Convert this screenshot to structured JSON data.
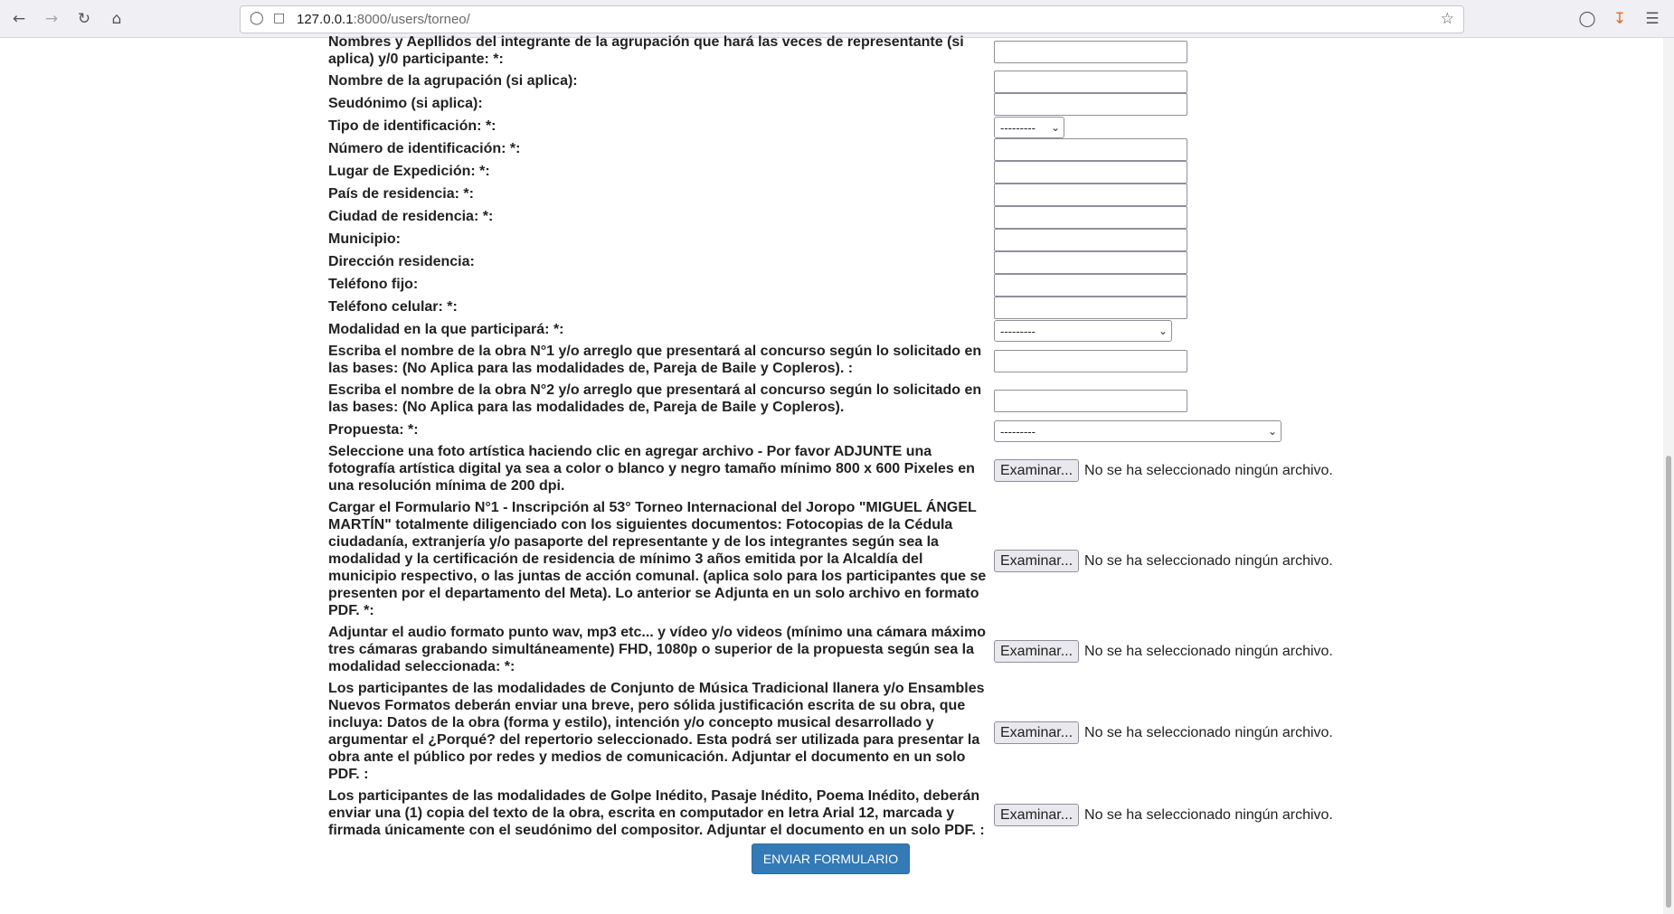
{
  "browser": {
    "url_host": "127.0.0.1",
    "url_rest": ":8000/users/torneo/"
  },
  "form": {
    "fields": [
      {
        "label": "Nombres y Aepllidos del integrante de la agrupación que hará las veces de representante (si aplica) y/0 participante: *:",
        "type": "text"
      },
      {
        "label": "Nombre de la agrupación (si aplica):",
        "type": "text"
      },
      {
        "label": "Seudónimo (si aplica):",
        "type": "text"
      },
      {
        "label": "Tipo de identificación: *:",
        "type": "select",
        "value": "---------"
      },
      {
        "label": "Número de identificación: *:",
        "type": "text"
      },
      {
        "label": "Lugar de Expedición: *:",
        "type": "text"
      },
      {
        "label": "País de residencia: *:",
        "type": "text"
      },
      {
        "label": "Ciudad de residencia: *:",
        "type": "text"
      },
      {
        "label": "Municipio:",
        "type": "text"
      },
      {
        "label": "Dirección residencia:",
        "type": "text"
      },
      {
        "label": "Teléfono fijo:",
        "type": "text"
      },
      {
        "label": "Teléfono celular: *:",
        "type": "text"
      },
      {
        "label": "Modalidad en la que participará: *:",
        "type": "select",
        "value": "---------"
      },
      {
        "label": "Escriba el nombre de la obra N°1 y/o arreglo que presentará al concurso según lo solicitado en las bases: (No Aplica para las modalidades de, Pareja de Baile y Copleros). :",
        "type": "text"
      },
      {
        "label": "Escriba el nombre de la obra N°2 y/o arreglo que presentará al concurso según lo solicitado en las bases: (No Aplica para las modalidades de, Pareja de Baile y Copleros).",
        "type": "text"
      },
      {
        "label": "Propuesta: *:",
        "type": "select",
        "value": "---------"
      },
      {
        "label": "Seleccione una foto artística haciendo clic en agregar archivo - Por favor ADJUNTE una fotografía artística digital ya sea a color o blanco y negro tamaño mínimo 800 x 600 Pixeles en una resolución mínima de 200 dpi.",
        "type": "file"
      },
      {
        "label": "Cargar el Formulario N°1 - Inscripción al 53° Torneo Internacional del Joropo \"MIGUEL ÁNGEL MARTÍN\" totalmente diligenciado con los siguientes documentos: Fotocopias de la Cédula ciudadanía, extranjería y/o pasaporte del representante y de los integrantes según sea la modalidad y la certificación de residencia de mínimo 3 años emitida por la Alcaldía del municipio respectivo, o las juntas de acción comunal. (aplica solo para los participantes que se presenten por el departamento del Meta). Lo anterior se Adjunta en un solo archivo en formato PDF. *:",
        "type": "file"
      },
      {
        "label": "Adjuntar el audio formato punto wav, mp3 etc... y vídeo y/o videos (mínimo una cámara máximo tres cámaras grabando simultáneamente) FHD, 1080p o superior de la propuesta según sea la modalidad seleccionada: *:",
        "type": "file"
      },
      {
        "label": "Los participantes de las modalidades de Conjunto de Música Tradicional llanera y/o Ensambles Nuevos Formatos deberán enviar una breve, pero sólida justificación escrita de su obra, que incluya: Datos de la obra (forma y estilo), intención y/o concepto musical desarrollado y argumentar el ¿Porqué? del repertorio seleccionado. Esta podrá ser utilizada para presentar la obra ante el público por redes y medios de comunicación. Adjuntar el documento en un solo PDF. :",
        "type": "file"
      },
      {
        "label": "Los participantes de las modalidades de Golpe Inédito, Pasaje Inédito, Poema Inédito, deberán enviar una (1) copia del texto de la obra, escrita en computador en letra Arial 12, marcada y firmada únicamente con el seudónimo del compositor. Adjuntar el documento en un solo PDF. :",
        "type": "file"
      }
    ],
    "file_button_label": "Examinar...",
    "file_status": "No se ha seleccionado ningún archivo.",
    "submit_label": "ENVIAR FORMULARIO"
  }
}
